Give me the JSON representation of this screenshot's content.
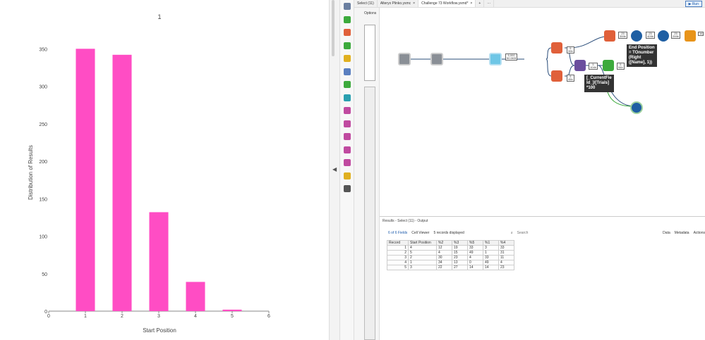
{
  "chart_data": {
    "type": "bar",
    "title": "1",
    "xlabel": "Start Position",
    "ylabel": "Distribution of Results",
    "x": [
      1,
      2,
      3,
      4,
      5
    ],
    "values": [
      350,
      342,
      132,
      39,
      2
    ],
    "xlim": [
      0,
      6
    ],
    "ylim": [
      0,
      370
    ],
    "xticks": [
      "0",
      "1",
      "2",
      "3",
      "4",
      "5",
      "6"
    ],
    "yticks": [
      "0",
      "50",
      "100",
      "150",
      "200",
      "250",
      "300",
      "350"
    ],
    "color": "#ff4dc4",
    "grid": false
  },
  "tabs": [
    {
      "label": "Select (11)"
    },
    {
      "label": "Alteryx Plinko.yxmc"
    },
    {
      "label": "Challenge 73 Workflow.yxmd*"
    }
  ],
  "run_label": "Run",
  "config": {
    "options_label": "Options"
  },
  "canvas": {
    "badges": [
      "5,000\n50.5KB",
      "5\n39b",
      "5\n45b",
      "5\n104b",
      "5\n94b",
      "25\n359b",
      "25\n409b",
      "25\n259b",
      "16"
    ],
    "formula1": "End Position\n= TOnumber\n(Right\n([Name], 1))",
    "formula2": "[_CurrentFie\nld_]/[Trials]\n*100"
  },
  "results": {
    "header": "Results - Select (11) - Output",
    "fields_label": "6 of 6 Fields",
    "cell_viewer_label": "Cell Viewer",
    "records_label": "5 records displayed",
    "search_placeholder": "Search",
    "data_label": "Data",
    "metadata_label": "Metadata",
    "actions_label": "Actions",
    "columns": [
      "Record",
      "Start Position",
      "%2",
      "%3",
      "%5",
      "%1",
      "%4"
    ],
    "rows": [
      [
        "1",
        "4",
        "12",
        "19",
        "33",
        "3",
        "33"
      ],
      [
        "2",
        "5",
        "4",
        "15",
        "49",
        "1",
        "31"
      ],
      [
        "3",
        "2",
        "30",
        "23",
        "4",
        "33",
        "11"
      ],
      [
        "4",
        "1",
        "34",
        "13",
        "0",
        "49",
        "4"
      ],
      [
        "5",
        "3",
        "22",
        "27",
        "14",
        "14",
        "23"
      ]
    ]
  }
}
